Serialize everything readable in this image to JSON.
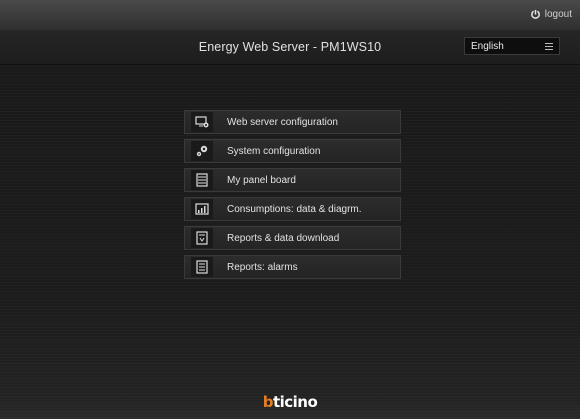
{
  "topbar": {
    "logout_label": "logout"
  },
  "header": {
    "title": "Energy Web Server - PM1WS10",
    "language": "English"
  },
  "menu": {
    "items": [
      {
        "label": "Web server configuration",
        "icon": "monitor-gear-icon"
      },
      {
        "label": "System configuration",
        "icon": "gears-icon"
      },
      {
        "label": "My panel board",
        "icon": "panel-board-icon"
      },
      {
        "label": "Consumptions: data & diagrm.",
        "icon": "chart-icon"
      },
      {
        "label": "Reports & data download",
        "icon": "report-download-icon"
      },
      {
        "label": "Reports: alarms",
        "icon": "report-alarm-icon"
      }
    ]
  },
  "footer": {
    "brand_b": "b",
    "brand_rest": "ticino"
  }
}
